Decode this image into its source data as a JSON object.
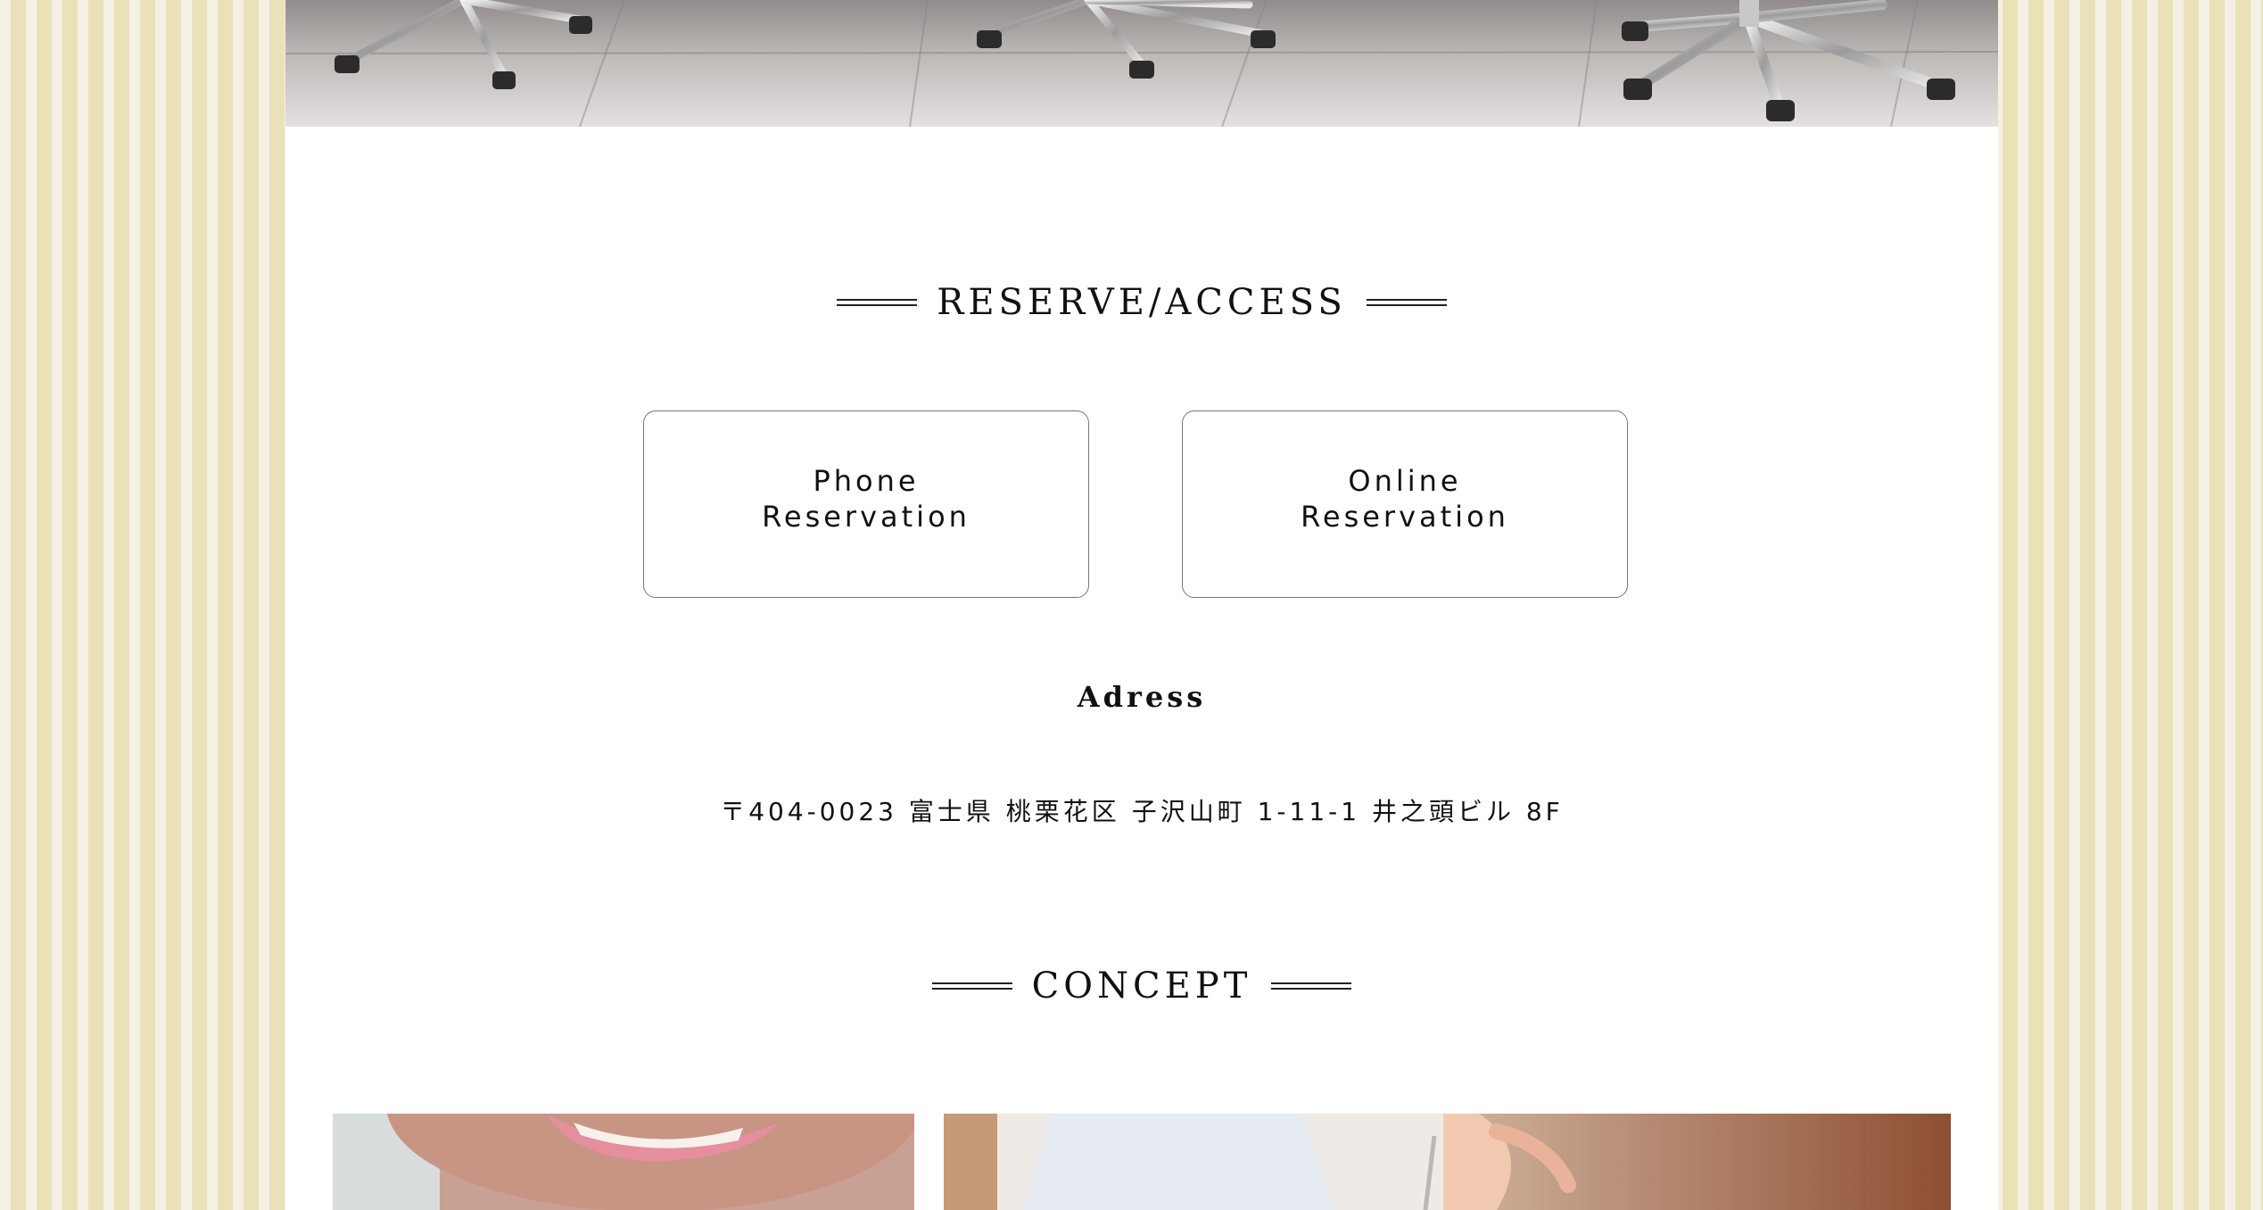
{
  "reserve_access": {
    "title": "RESERVE/ACCESS",
    "phone_button": "Phone\nReservation",
    "online_button": "Online\nReservation",
    "address_heading": "Adress",
    "address": "〒404-0023 富士県 桃栗花区 子沢山町 1-11-1 井之頭ビル 8F"
  },
  "concept": {
    "title": "CONCEPT"
  },
  "colors": {
    "stripe_light": "#f4f0e4",
    "stripe_dark": "#ebe1b9",
    "content_bg": "#ffffff",
    "text": "#111111"
  }
}
